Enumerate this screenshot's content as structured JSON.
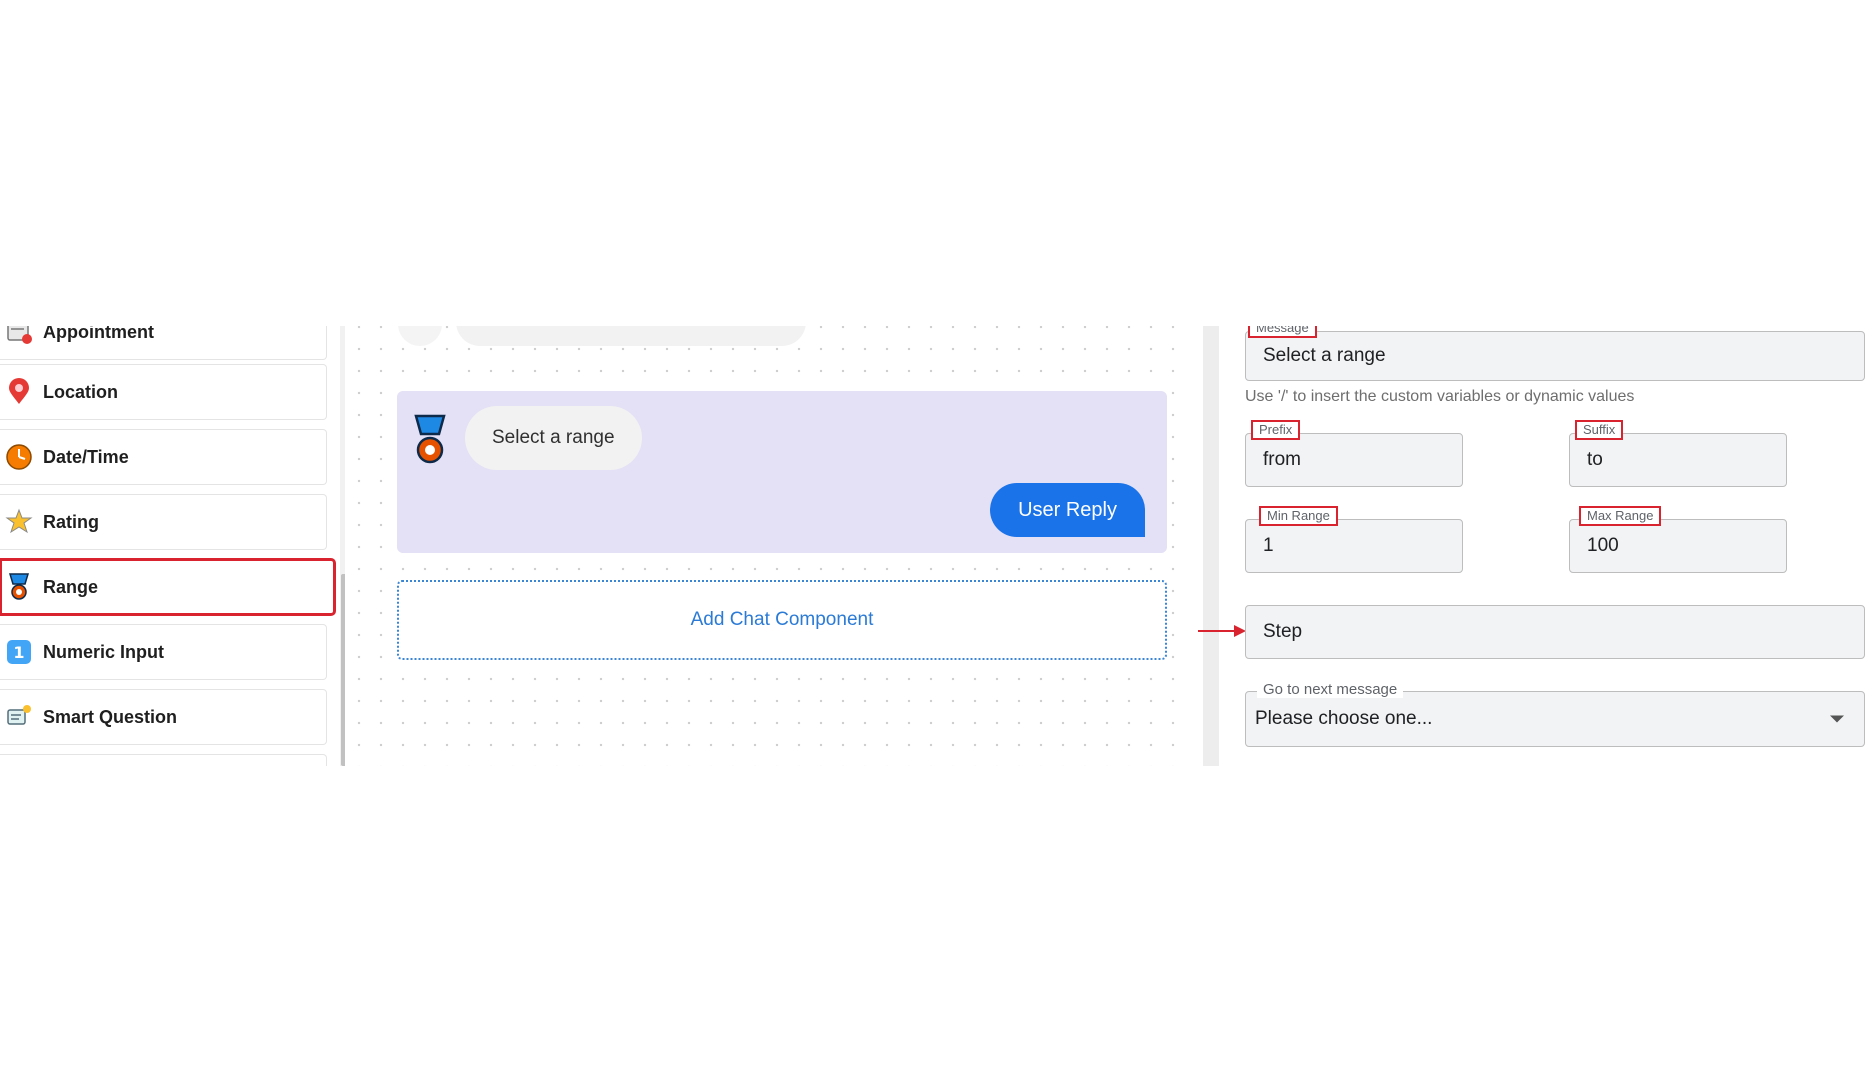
{
  "sidebar": {
    "items": [
      {
        "label": "Appointment",
        "icon": "appointment-icon"
      },
      {
        "label": "Location",
        "icon": "location-pin-icon"
      },
      {
        "label": "Date/Time",
        "icon": "clock-icon"
      },
      {
        "label": "Rating",
        "icon": "star-icon"
      },
      {
        "label": "Range",
        "icon": "medal-icon",
        "selected": true
      },
      {
        "label": "Numeric Input",
        "icon": "numeric-one-icon"
      },
      {
        "label": "Smart Question",
        "icon": "smart-question-icon"
      }
    ]
  },
  "canvas": {
    "message_text": "Select a range",
    "user_reply_label": "User Reply",
    "add_component_label": "Add Chat Component"
  },
  "form": {
    "message": {
      "label": "Message",
      "value": "Select a range"
    },
    "hint": "Use '/' to insert the custom variables or dynamic values",
    "prefix": {
      "label": "Prefix",
      "value": "from"
    },
    "suffix": {
      "label": "Suffix",
      "value": "to"
    },
    "min_range": {
      "label": "Min Range",
      "value": "1"
    },
    "max_range": {
      "label": "Max Range",
      "value": "100"
    },
    "step": {
      "placeholder": "Step"
    },
    "goto": {
      "label": "Go to next message",
      "selected": "Please choose one..."
    }
  },
  "colors": {
    "accent": "#1a73e8",
    "highlight": "#d9232e",
    "card_bg": "#e4e0f5"
  }
}
